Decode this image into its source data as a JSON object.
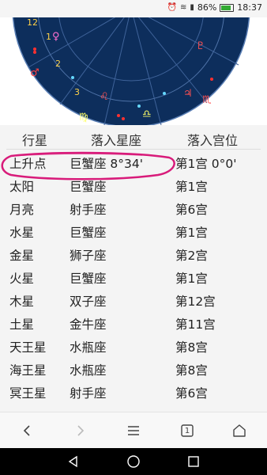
{
  "status": {
    "battery_percent": "86%",
    "time": "18:37",
    "battery_level": 0.86
  },
  "table": {
    "headers": [
      "行星",
      "落入星座",
      "落入宫位"
    ],
    "rows": [
      {
        "planet": "上升点",
        "sign": "巨蟹座 8°34'",
        "house": "第1宫 0°0'"
      },
      {
        "planet": "太阳",
        "sign": "巨蟹座",
        "house": "第1宫"
      },
      {
        "planet": "月亮",
        "sign": "射手座",
        "house": "第6宫"
      },
      {
        "planet": "水星",
        "sign": "巨蟹座",
        "house": "第1宫"
      },
      {
        "planet": "金星",
        "sign": "狮子座",
        "house": "第2宫"
      },
      {
        "planet": "火星",
        "sign": "巨蟹座",
        "house": "第1宫"
      },
      {
        "planet": "木星",
        "sign": "双子座",
        "house": "第12宫"
      },
      {
        "planet": "土星",
        "sign": "金牛座",
        "house": "第11宫"
      },
      {
        "planet": "天王星",
        "sign": "水瓶座",
        "house": "第8宫"
      },
      {
        "planet": "海王星",
        "sign": "水瓶座",
        "house": "第8宫"
      },
      {
        "planet": "冥王星",
        "sign": "射手座",
        "house": "第6宫"
      }
    ]
  },
  "chart": {
    "house_numbers": [
      "2",
      "3",
      "12",
      "1"
    ],
    "glyphs": [
      "♀",
      "♂",
      "♍",
      "♌",
      "♎",
      "♏",
      "♃",
      "♇"
    ]
  },
  "browser": {
    "tab_count": "1",
    "icons": [
      "back-icon",
      "forward-icon",
      "menu-icon",
      "tabs-icon",
      "home-icon"
    ]
  },
  "colors": {
    "chart_bg": "#0d2e5c",
    "highlight": "#d81b7a"
  }
}
